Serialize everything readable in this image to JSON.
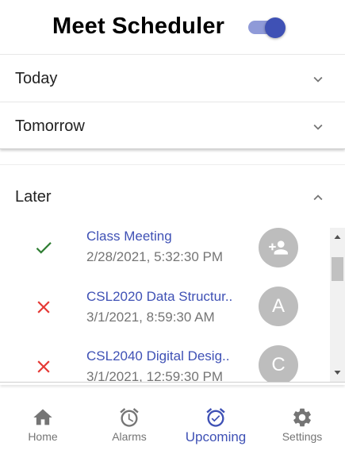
{
  "app": {
    "title": "Meet Scheduler",
    "toggle_on": true,
    "accent_color": "#3f51b5"
  },
  "sections": [
    {
      "label": "Today",
      "expanded": false
    },
    {
      "label": "Tomorrow",
      "expanded": false
    },
    {
      "label": "Later",
      "expanded": true
    }
  ],
  "later_items": [
    {
      "title": "Class Meeting",
      "time": "2/28/2021, 5:32:30 PM",
      "status": "check-icon",
      "avatar": "",
      "avatar_icon": "person-add-icon"
    },
    {
      "title": "CSL2020 Data Structur..",
      "time": "3/1/2021, 8:59:30 AM",
      "status": "cross-icon",
      "avatar": "A"
    },
    {
      "title": "CSL2040 Digital Desig..",
      "time": "3/1/2021, 12:59:30 PM",
      "status": "cross-icon",
      "avatar": "C"
    }
  ],
  "nav": [
    {
      "label": "Home",
      "icon": "home-icon",
      "active": false
    },
    {
      "label": "Alarms",
      "icon": "alarm-icon",
      "active": false
    },
    {
      "label": "Upcoming",
      "icon": "alarm-check-icon",
      "active": true
    },
    {
      "label": "Settings",
      "icon": "gear-icon",
      "active": false
    }
  ]
}
